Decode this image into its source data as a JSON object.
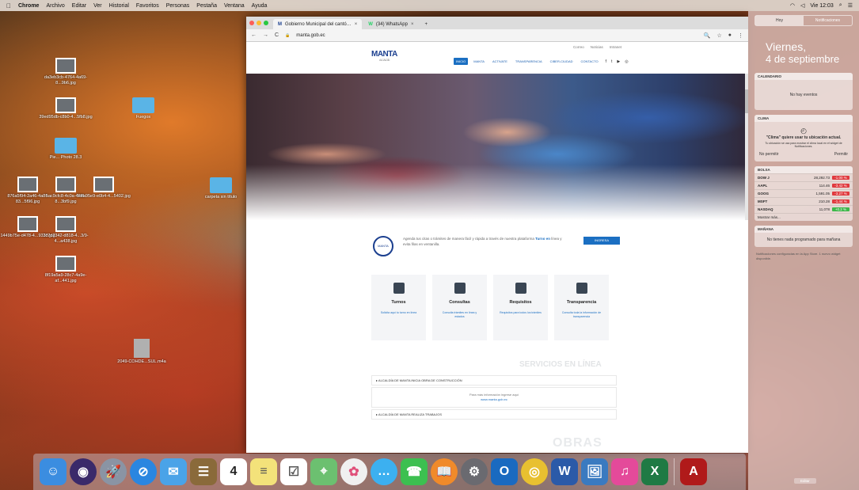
{
  "menubar": {
    "apple": "",
    "items": [
      "Chrome",
      "Archivo",
      "Editar",
      "Ver",
      "Historial",
      "Favoritos",
      "Personas",
      "Pestaña",
      "Ventana",
      "Ayuda"
    ],
    "time": "Vie 12:03"
  },
  "desktop": {
    "icons": [
      {
        "label": "da3eb3cb-4764-4a69-8...9b6.jpg",
        "kind": "image"
      },
      {
        "label": "39ed95db-c8b0-4...5fb8.jpg",
        "kind": "image"
      },
      {
        "label": "Pie...\nPhoto 28.3",
        "kind": "folder"
      },
      {
        "label": "Fuegos",
        "kind": "folder"
      },
      {
        "label": "876a5f94-2a46-4a8f-83...5f96.jpg",
        "kind": "image"
      },
      {
        "label": "5ac9cfc8-4c0a-44fd-8...3bf9.jpg",
        "kind": "image"
      },
      {
        "label": "5dfa95e9-e0b4-4...5402.jpg",
        "kind": "image"
      },
      {
        "label": "carpeta sin título",
        "kind": "folder"
      },
      {
        "label": "1449b75e-d478-4...9333.jpg",
        "kind": "image"
      },
      {
        "label": "3c7d2342-d818-4...3/9-4...a438.jpg",
        "kind": "image"
      },
      {
        "label": "8f19a5a9-28c7-4a9e-af...441.jpg",
        "kind": "image"
      },
      {
        "label": "2049-COHDE...SUL.m4a",
        "kind": "file"
      }
    ]
  },
  "browser": {
    "tabs": [
      {
        "title": "Gobierno Municipal del cantó…",
        "favicon": "M",
        "active": true
      },
      {
        "title": "(34) WhatsApp",
        "favicon": "W",
        "active": false
      }
    ],
    "close_glyph": "×",
    "new_tab_glyph": "+",
    "nav_back": "←",
    "nav_forward": "→",
    "nav_reload": "C",
    "secure_glyph": "🔒",
    "url": "manta.gob.ec",
    "toolbar_right": [
      "🔍",
      "☆",
      "●",
      "⋮"
    ]
  },
  "site": {
    "logo": "MANTA",
    "logo_sub": "ALCALDÍA",
    "util_links": [
      "Correo",
      "Noticias",
      "Intranet"
    ],
    "nav": [
      {
        "label": "INICIO",
        "active": true
      },
      {
        "label": "MANTA",
        "active": false
      },
      {
        "label": "ACTIVATE",
        "active": false
      },
      {
        "label": "TRANSPARENCIA",
        "active": false
      },
      {
        "label": "CIBER-CIUDAD",
        "active": false
      },
      {
        "label": "CONTACTO",
        "active": false
      }
    ],
    "social": [
      "f",
      "t",
      "▶",
      "◎"
    ],
    "intro": {
      "icon_text": "MANTA",
      "text_pre": "Agenda tus citas o trámites de manera fácil y rápida a través de nuestra plataforma",
      "text_link": "Turno en",
      "text_post": "línea y evita filas en ventanilla.",
      "button": "INGRESA"
    },
    "cards": [
      {
        "title": "Turnos",
        "desc": "Solicita aquí tu turno en línea"
      },
      {
        "title": "Consultas",
        "desc": "Consulta trámites en línea y estados"
      },
      {
        "title": "Requisitos",
        "desc": "Requisitos para todos los trámites"
      },
      {
        "title": "Transparencia",
        "desc": "Consulta toda la información de transparencia"
      }
    ],
    "ghost_title": "SERVICIOS EN LÍNEA",
    "accordion": [
      {
        "label": "▸ ALCALDÍA DE MANTA INICIA OBRA DE CONSTRUCCIÓN"
      },
      {
        "label": "▸ ALCALDÍA DE MANTA REALIZA TRABAJOS"
      }
    ],
    "accordion_body": "Para más información ingrese aquí",
    "accordion_link": "www.manta.gob.ec",
    "ghost_title2": "OBRAS"
  },
  "notifications": {
    "tabs": [
      {
        "label": "Hoy",
        "active": true
      },
      {
        "label": "Notificaciones",
        "active": false
      }
    ],
    "day": "Viernes,",
    "date": "4 de septiembre",
    "calendar": {
      "header": "CALENDARIO",
      "body": "No hay eventos"
    },
    "weather": {
      "header": "CLIMA",
      "title": "\"Clima\" quiere usar tu ubicación actual.",
      "body": "Tu ubicación se usa para mostrar el clima local en el widget de Notificaciones.",
      "deny": "No permitir",
      "allow": "Permitir"
    },
    "stocks": {
      "header": "BOLSA",
      "rows": [
        {
          "sym": "DOW J",
          "val": "28,292.73",
          "chg": "-1.00 %",
          "dir": "neg"
        },
        {
          "sym": "AAPL",
          "val": "114.46",
          "chg": "-3.42 %",
          "dir": "neg"
        },
        {
          "sym": "GOOG",
          "val": "1,591.05",
          "chg": "-3.27 %",
          "dir": "neg"
        },
        {
          "sym": "MSFT",
          "val": "210.28",
          "chg": "-1.44 %",
          "dir": "neg"
        },
        {
          "sym": "NASDAQ",
          "val": "11,078",
          "chg": "+0.2 %",
          "dir": "pos"
        }
      ],
      "more": "Mostrar más..."
    },
    "tomorrow": {
      "header": "MAÑANA",
      "body": "No tienes nada programado para mañana"
    },
    "footer": "Notificaciones configuradas en la App Store. 1 nuevo widget disponible.",
    "edit": "Editar"
  },
  "dock": {
    "apps": [
      {
        "name": "finder",
        "glyph": "☺",
        "color": "#3b8de0"
      },
      {
        "name": "siri",
        "glyph": "◉",
        "color": "#3a2a6a"
      },
      {
        "name": "launchpad",
        "glyph": "🚀",
        "color": "#8a94a4"
      },
      {
        "name": "safari",
        "glyph": "⊘",
        "color": "#2a86e0"
      },
      {
        "name": "mail",
        "glyph": "✉",
        "color": "#4aa3e8"
      },
      {
        "name": "contacts",
        "glyph": "☰",
        "color": "#8a6a3a"
      },
      {
        "name": "calendar",
        "glyph": "4",
        "color": "#ffffff"
      },
      {
        "name": "notes",
        "glyph": "≡",
        "color": "#f3e27a"
      },
      {
        "name": "reminders",
        "glyph": "☑",
        "color": "#ffffff"
      },
      {
        "name": "maps",
        "glyph": "⌖",
        "color": "#6cc070"
      },
      {
        "name": "photos",
        "glyph": "✿",
        "color": "#f0f0f0"
      },
      {
        "name": "messages",
        "glyph": "…",
        "color": "#3cb0f0"
      },
      {
        "name": "facetime",
        "glyph": "☎",
        "color": "#3cc050"
      },
      {
        "name": "books",
        "glyph": "📖",
        "color": "#f08a2a"
      },
      {
        "name": "system-preferences",
        "glyph": "⚙",
        "color": "#6a6a70"
      },
      {
        "name": "outlook",
        "glyph": "O",
        "color": "#1a6ac0"
      },
      {
        "name": "chrome",
        "glyph": "◎",
        "color": "#e8c030"
      },
      {
        "name": "word",
        "glyph": "W",
        "color": "#2b5aa8"
      },
      {
        "name": "preview",
        "glyph": "🖼",
        "color": "#3a7ac0"
      },
      {
        "name": "itunes",
        "glyph": "♫",
        "color": "#e44a9a"
      },
      {
        "name": "excel",
        "glyph": "X",
        "color": "#1f7a44"
      },
      {
        "name": "acrobat",
        "glyph": "A",
        "color": "#b01a1a"
      }
    ]
  }
}
